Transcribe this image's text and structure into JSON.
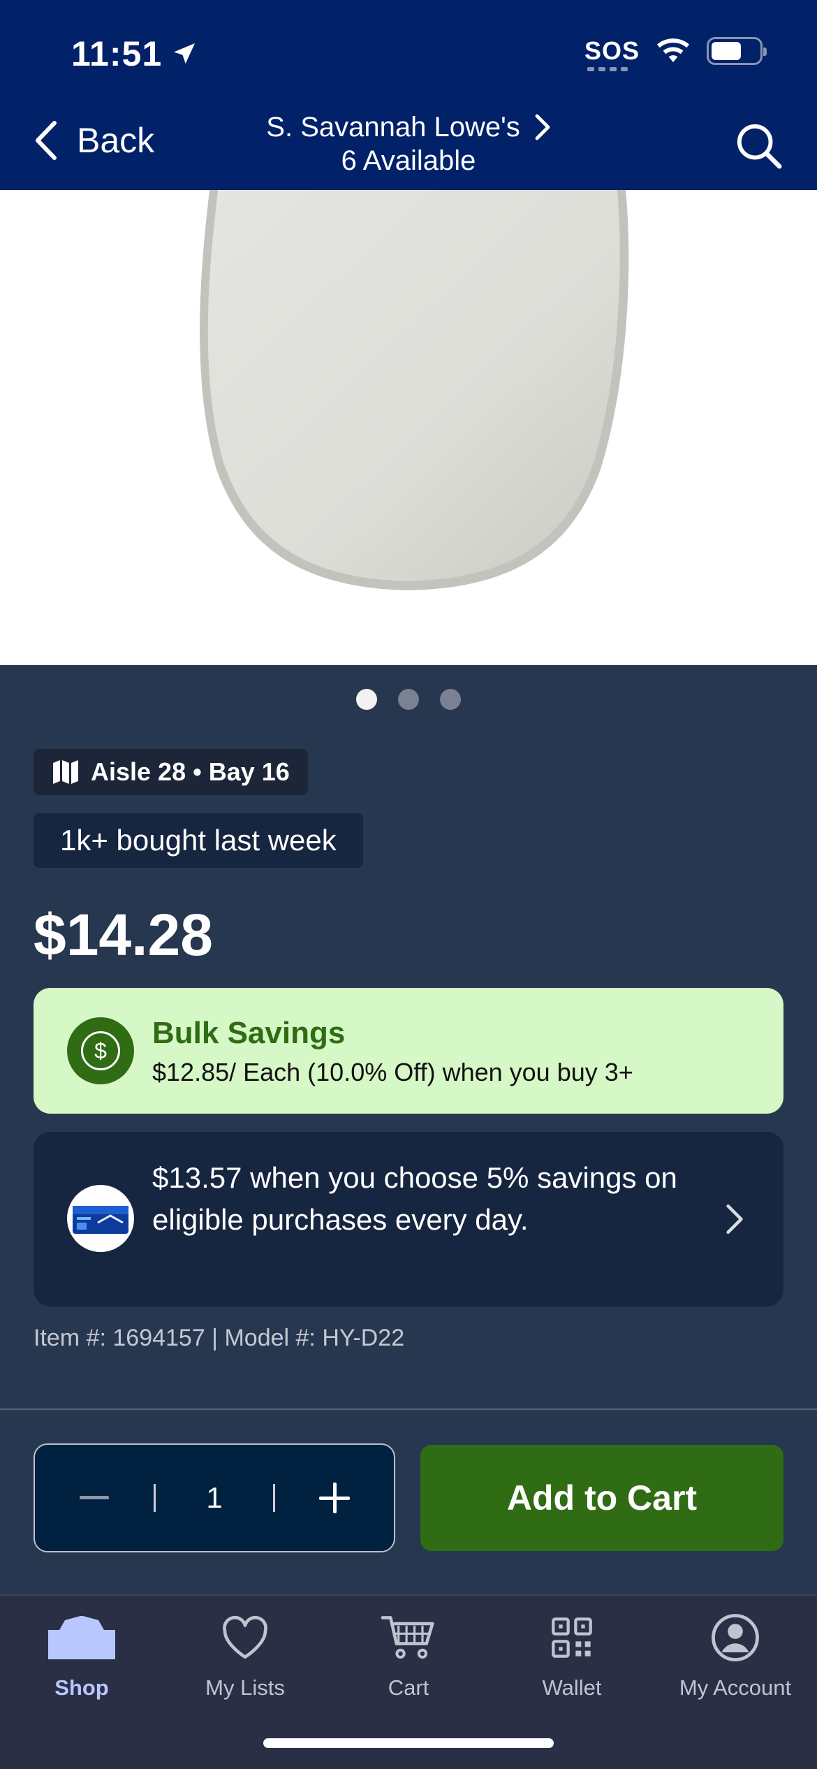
{
  "status_bar": {
    "time": "11:51",
    "sos": "SOS"
  },
  "header": {
    "back_label": "Back",
    "store_name": "S. Savannah Lowe's",
    "availability": "6 Available"
  },
  "gallery": {
    "count": 3,
    "active_index": 0
  },
  "product": {
    "location": "Aisle 28 • Bay 16",
    "social_proof": "1k+ bought last week",
    "price": "$14.28",
    "bulk_title": "Bulk Savings",
    "bulk_detail": "$12.85/ Each (10.0% Off) when you buy 3+",
    "card_offer": "$13.57 when you choose 5% savings on eligible purchases every day.",
    "item_model": "Item #: 1694157 | Model #: HY-D22"
  },
  "purchase": {
    "quantity": "1",
    "add_to_cart_label": "Add to Cart"
  },
  "tabbar": {
    "items": [
      {
        "label": "Shop",
        "icon": "shop-icon"
      },
      {
        "label": "My Lists",
        "icon": "heart-icon"
      },
      {
        "label": "Cart",
        "icon": "cart-icon"
      },
      {
        "label": "Wallet",
        "icon": "qr-code-icon"
      },
      {
        "label": "My Account",
        "icon": "account-icon"
      }
    ],
    "active": "Shop"
  },
  "colors": {
    "header_bg": "#012169",
    "page_bg": "#283750",
    "bulk_bg": "#d6f7c6",
    "accent_green": "#2f6c14",
    "card_bg": "#162540"
  }
}
